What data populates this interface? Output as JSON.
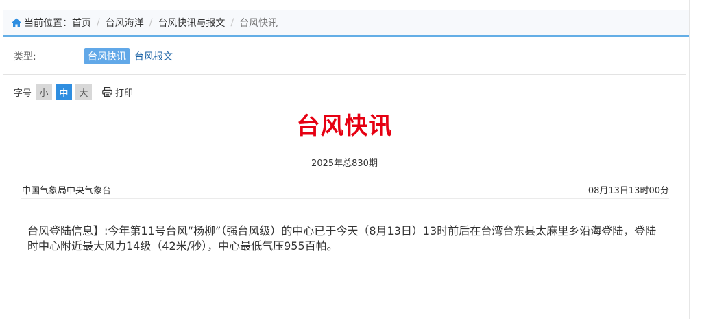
{
  "breadcrumb": {
    "prefix": "当前位置：",
    "items": [
      "首页",
      "台风海洋",
      "台风快讯与报文"
    ],
    "current": "台风快讯",
    "separator": "/"
  },
  "type_filter": {
    "label": "类型:",
    "options": [
      "台风快讯",
      "台风报文"
    ],
    "selected": "台风快讯"
  },
  "font_size": {
    "label": "字号",
    "options": [
      "小",
      "中",
      "大"
    ],
    "selected": "中"
  },
  "print": {
    "label": "打印"
  },
  "document": {
    "title": "台风快讯",
    "issue": "2025年总830期",
    "agency": "中国气象局中央气象台",
    "time": "08月13日13时00分",
    "body": "台风登陆信息】:今年第11号台风“杨柳”（强台风级）的中心已于今天（8月13日）13时前后在台湾台东县太麻里乡沿海登陆，登陆时中心附近最大风力14级（42米/秒），中心最低气压955百帕。"
  },
  "colors": {
    "accent": "#64aee6",
    "title_red": "#e60012",
    "tag_active": "#61a8e8",
    "font_btn_active": "#2f8ee0"
  }
}
